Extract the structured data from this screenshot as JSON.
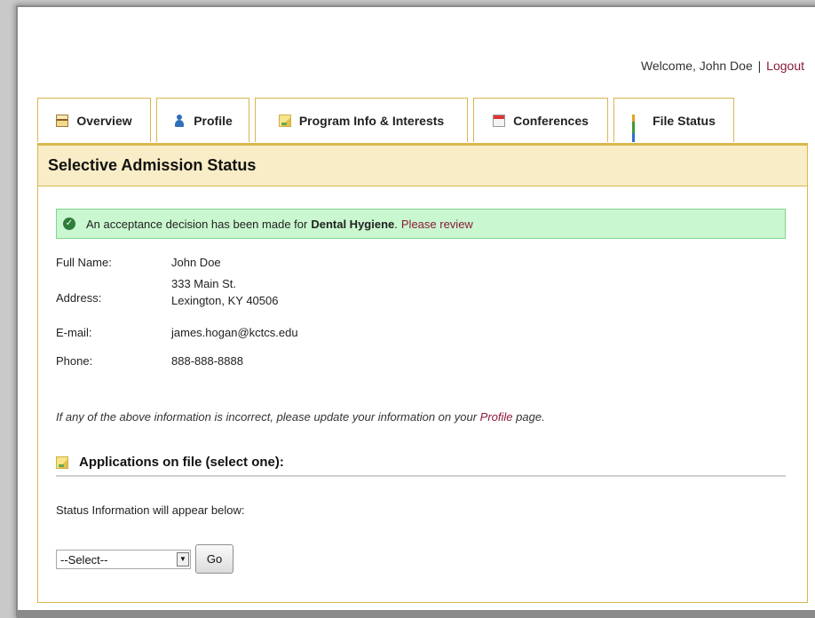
{
  "header": {
    "welcome_text": "Welcome, John Doe",
    "separator": "|",
    "logout_label": "Logout"
  },
  "tabs": [
    {
      "label": "Overview",
      "icon": "overview-icon"
    },
    {
      "label": "Profile",
      "icon": "profile-icon"
    },
    {
      "label": "Program Info & Interests",
      "icon": "note-icon"
    },
    {
      "label": "Conferences",
      "icon": "calendar-icon"
    },
    {
      "label": "File Status",
      "icon": "chart-icon"
    }
  ],
  "section": {
    "title": "Selective Admission Status"
  },
  "alert": {
    "text": "An acceptance decision has been made for",
    "program": "Dental Hygiene",
    "period": ".",
    "link_label": "Please review"
  },
  "info": {
    "full_name_label": "Full Name:",
    "full_name": "John Doe",
    "address_label": "Address:",
    "address_line1": "333 Main St.",
    "address_line2": "Lexington, KY 40506",
    "email_label": "E-mail:",
    "email": "james.hogan@kctcs.edu",
    "phone_label": "Phone:",
    "phone": "888-888-8888"
  },
  "note": {
    "text_before": "If any of the above information is incorrect, please update your information on your",
    "link_label": "Profile",
    "text_after": "page."
  },
  "applications": {
    "heading": "Applications on file (select one):",
    "status_text": "Status Information will appear below:",
    "select_value": "--Select--",
    "go_label": "Go"
  },
  "colors": {
    "accent_border": "#d9b64e",
    "header_band": "#f8edc6",
    "link": "#8b1a3a",
    "success_bg": "#c9f7cf"
  }
}
